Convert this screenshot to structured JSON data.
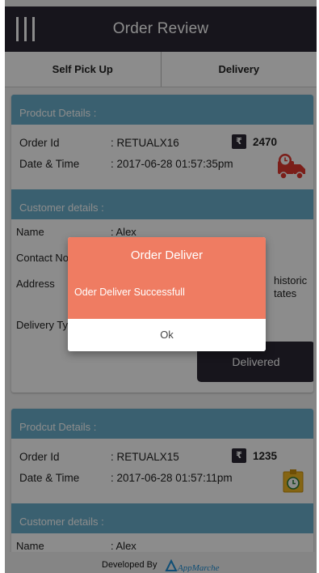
{
  "header": {
    "title": "Order Review",
    "menu_icon": "hamburger-icon"
  },
  "tabs": [
    {
      "label": "Self Pick Up"
    },
    {
      "label": "Delivery"
    }
  ],
  "orders": [
    {
      "product_section": "Prodcut Details :",
      "order_id_label": "Order Id",
      "order_id": ": RETUALX16",
      "datetime_label": "Date & Time",
      "datetime": ": 2017-06-28 01:57:35pm",
      "currency_symbol": "₹",
      "amount": "2470",
      "status_icon": "delivery-truck-clock-icon",
      "customer_section": "Customer details :",
      "name_label": "Name",
      "name": ": Alex",
      "contact_label": "Contact No",
      "address_label": "Address",
      "address_tail_1": "historic",
      "address_tail_2": "tates",
      "delivery_type_label": "Delivery Type",
      "action_button": "Delivered"
    },
    {
      "product_section": "Prodcut Details :",
      "order_id_label": "Order Id",
      "order_id": ": RETUALX15",
      "datetime_label": "Date & Time",
      "datetime": ": 2017-06-28 01:57:11pm",
      "currency_symbol": "₹",
      "amount": "1235",
      "status_icon": "package-clock-icon",
      "customer_section": "Customer details :",
      "name_label": "Name",
      "name": ": Alex"
    }
  ],
  "dialog": {
    "title": "Order Deliver",
    "message": "Oder Deliver Successfull",
    "ok_label": "Ok"
  },
  "footer": {
    "developed_by": "Developed By",
    "brand": "AppMarche"
  },
  "colors": {
    "header_bg": "#2a2734",
    "section_bg": "#6ab0cc",
    "dialog_accent": "#ef7c62",
    "truck_icon": "#e0382f",
    "package_icon": "#f2b824"
  }
}
